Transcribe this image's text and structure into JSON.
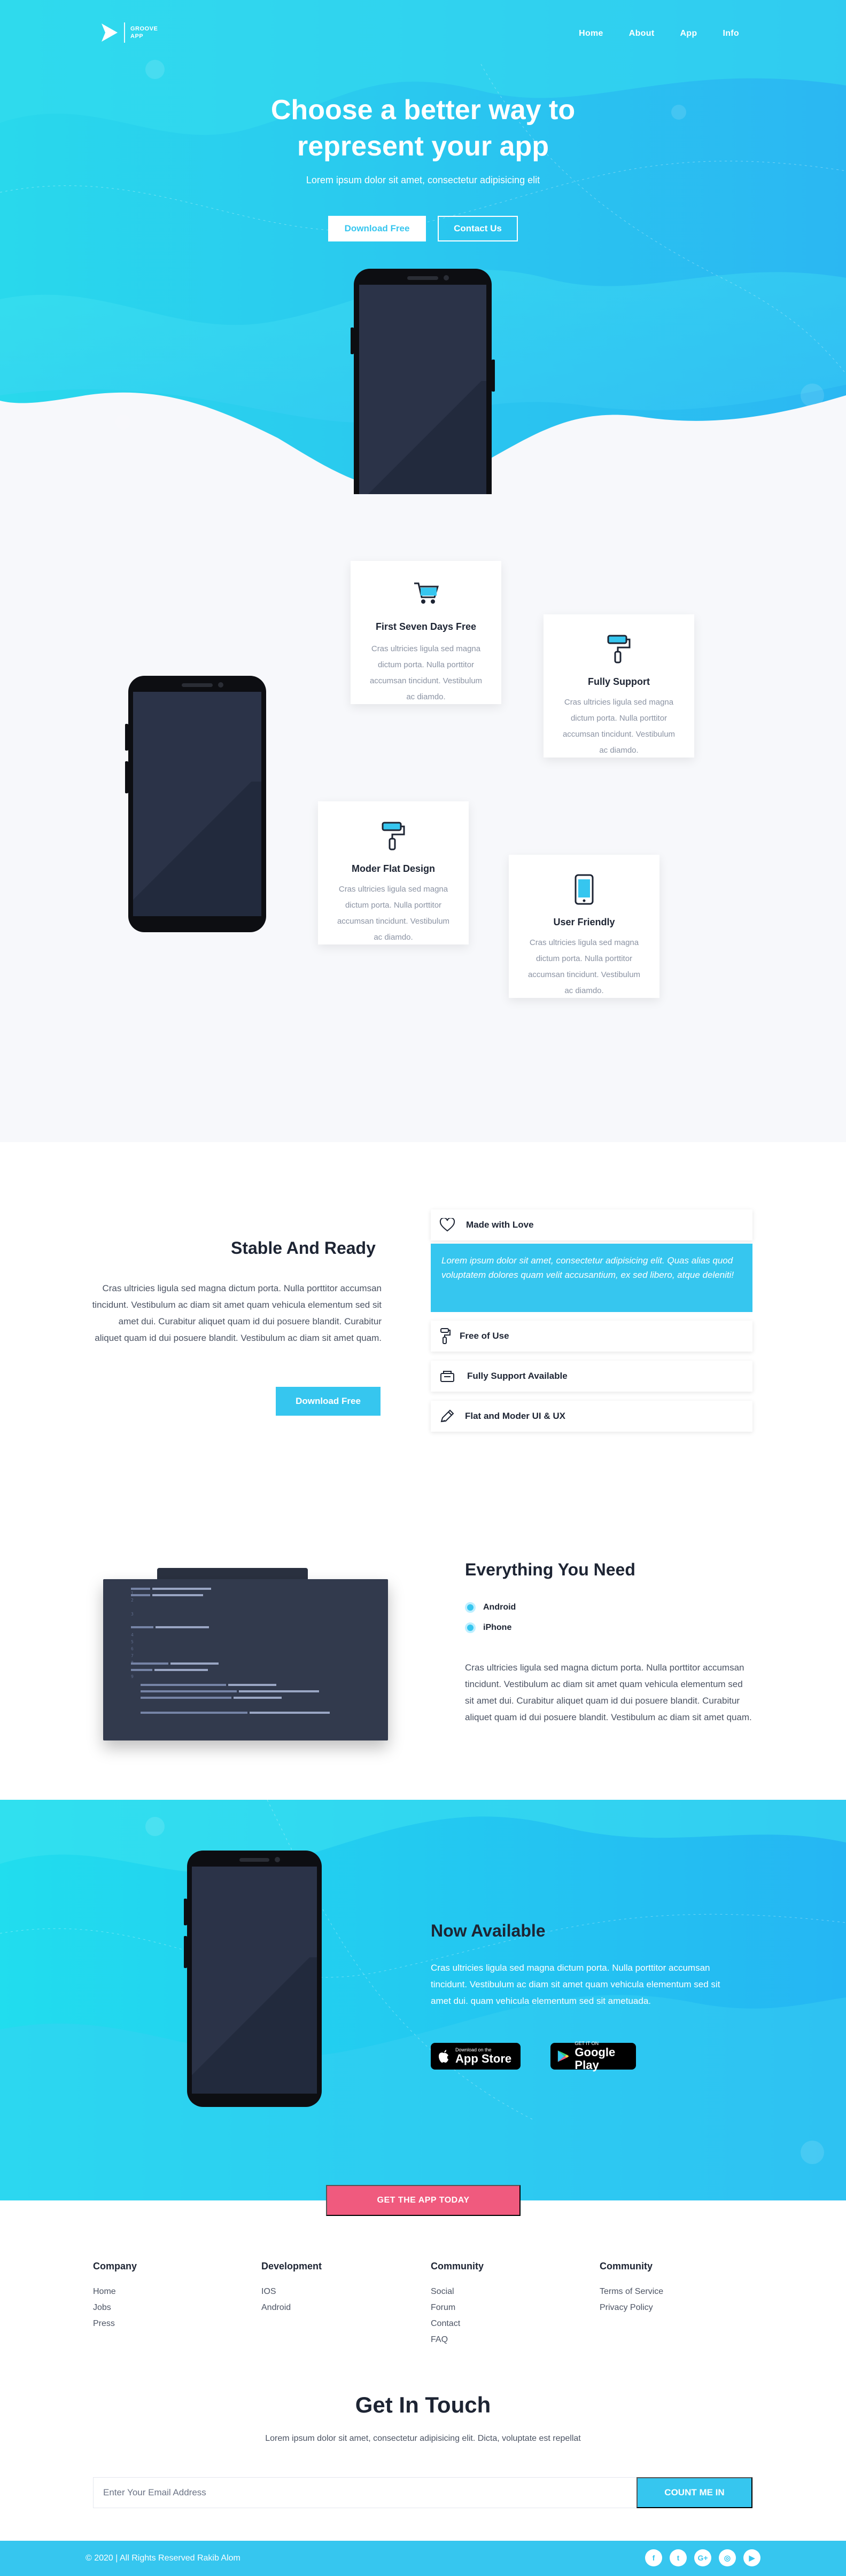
{
  "brand": {
    "logo_text": "GROOVE APP",
    "accent": "#36c6ef",
    "pink": "#f05a7e"
  },
  "nav": {
    "items": [
      "Home",
      "About",
      "App",
      "Info"
    ]
  },
  "hero": {
    "title_line1": "Choose a better way to",
    "title_line2": "represent your app",
    "subtitle": "Lorem ipsum dolor sit amet, consectetur adipisicing elit",
    "primary_button": "Download Free",
    "secondary_button": "Contact Us"
  },
  "features": [
    {
      "icon": "shopping-cart-icon",
      "title": "First Seven Days Free",
      "text": "Cras ultricies ligula sed magna dictum porta. Nulla porttitor accumsan tincidunt. Vestibulum ac diamdo."
    },
    {
      "icon": "paint-roller-icon",
      "title": "Fully Support",
      "text": "Cras ultricies ligula sed magna dictum porta. Nulla porttitor accumsan tincidunt. Vestibulum ac diamdo."
    },
    {
      "icon": "paint-roller-icon",
      "title": "Moder Flat Design",
      "text": "Cras ultricies ligula sed magna dictum porta. Nulla porttitor accumsan tincidunt. Vestibulum ac diamdo."
    },
    {
      "icon": "smartphone-icon",
      "title": "User Friendly",
      "text": "Cras ultricies ligula sed magna dictum porta. Nulla porttitor accumsan tincidunt. Vestibulum ac diamdo."
    }
  ],
  "stable": {
    "title": "Stable And Ready",
    "text": "Cras ultricies ligula sed magna dictum porta. Nulla porttitor accumsan tincidunt. Vestibulum ac diam sit amet quam vehicula elementum sed sit amet dui. Curabitur aliquet quam id dui posuere blandit. Curabitur aliquet quam id dui posuere blandit. Vestibulum ac diam sit amet quam.",
    "button": "Download Free",
    "accordion": [
      {
        "icon": "heart-icon",
        "label": "Made with Love"
      },
      {
        "icon": "paint-roller-icon",
        "label": "Free of Use"
      },
      {
        "icon": "support-box-icon",
        "label": "Fully Support Available"
      },
      {
        "icon": "pencil-icon",
        "label": "Flat and Moder UI & UX"
      }
    ],
    "accordion_open_text": "Lorem ipsum dolor sit amet, consectetur adipisicing elit. Quas alias quod voluptatem dolores quam velit accusantium, ex sed libero, atque deleniti!"
  },
  "everything": {
    "title": "Everything You Need",
    "options": [
      "Android",
      "iPhone"
    ],
    "text": "Cras ultricies ligula sed magna dictum porta. Nulla porttitor accumsan tincidunt. Vestibulum ac diam sit amet quam vehicula elementum sed sit amet dui. Curabitur aliquet quam id dui posuere blandit. Curabitur aliquet quam id dui posuere blandit. Vestibulum ac diam sit amet quam."
  },
  "available": {
    "title": "Now Available",
    "text": "Cras ultricies ligula sed magna dictum porta. Nulla porttitor accumsan tincidunt. Vestibulum ac diam sit amet quam vehicula elementum sed sit amet dui. quam vehicula elementum sed sit ametuada.",
    "appstore_small": "Download on the",
    "appstore_big": "App Store",
    "play_small": "GET IT ON",
    "play_big": "Google Play",
    "cta": "GET THE APP TODAY"
  },
  "footer": {
    "columns": [
      {
        "title": "Company",
        "links": [
          "Home",
          "Jobs",
          "Press"
        ]
      },
      {
        "title": "Development",
        "links": [
          "IOS",
          "Android"
        ]
      },
      {
        "title": "Community",
        "links": [
          "Social",
          "Forum",
          "Contact",
          "FAQ"
        ]
      },
      {
        "title": "Community",
        "links": [
          "Terms of Service",
          "Privacy Policy"
        ]
      }
    ],
    "touch_title": "Get In Touch",
    "touch_sub": "Lorem ipsum dolor sit amet, consectetur adipisicing elit. Dicta, voluptate est repellat",
    "email_placeholder": "Enter Your Email Address",
    "count_button": "COUNT ME IN",
    "copyright": "© 2020 | All Rights Reserved Rakib Alom",
    "social": [
      {
        "icon": "facebook-icon",
        "glyph": "f"
      },
      {
        "icon": "twitter-icon",
        "glyph": "t"
      },
      {
        "icon": "google-plus-icon",
        "glyph": "G+"
      },
      {
        "icon": "instagram-icon",
        "glyph": "◎"
      },
      {
        "icon": "youtube-icon",
        "glyph": "▶"
      }
    ]
  }
}
